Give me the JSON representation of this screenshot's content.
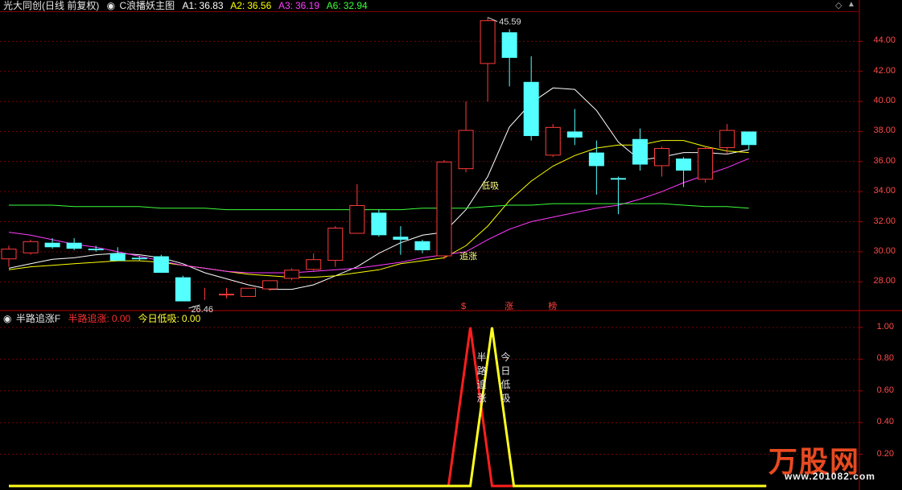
{
  "header": {
    "title": "光大同创(日线 前复权)",
    "indicator": "C浪播妖主图",
    "ma": [
      {
        "label": "A1:",
        "value": "36.83",
        "color": "#ffffff"
      },
      {
        "label": "A2:",
        "value": "36.56",
        "color": "#ffff00"
      },
      {
        "label": "A3:",
        "value": "36.19",
        "color": "#ff3cff"
      },
      {
        "label": "A6:",
        "value": "32.94",
        "color": "#3cff3c"
      }
    ]
  },
  "sub_header": {
    "title": "半路追涨F",
    "items": [
      {
        "label": "半路追涨:",
        "value": "0.00",
        "color": "#ff3030"
      },
      {
        "label": "今日低吸:",
        "value": "0.00",
        "color": "#ffff30"
      }
    ]
  },
  "colors": {
    "up": "#ff3b3b",
    "down": "#54ffff",
    "axis": "#b40000",
    "grid": "#7a0000"
  },
  "chart_data": [
    {
      "type": "candlestick",
      "y_ticks": [
        "28.00",
        "30.00",
        "32.00",
        "34.00",
        "36.00",
        "38.00",
        "40.00",
        "42.00",
        "44.00"
      ],
      "ylim": [
        26.3,
        46.0
      ],
      "grid": true,
      "candles": [
        {
          "o": 29.5,
          "h": 30.4,
          "l": 29.0,
          "c": 30.2
        },
        {
          "o": 29.9,
          "h": 30.8,
          "l": 29.8,
          "c": 30.7
        },
        {
          "o": 30.6,
          "h": 30.9,
          "l": 30.2,
          "c": 30.3
        },
        {
          "o": 30.6,
          "h": 30.9,
          "l": 30.1,
          "c": 30.2
        },
        {
          "o": 30.2,
          "h": 30.4,
          "l": 30.0,
          "c": 30.1
        },
        {
          "o": 29.9,
          "h": 30.3,
          "l": 29.4,
          "c": 29.4
        },
        {
          "o": 29.6,
          "h": 29.7,
          "l": 29.4,
          "c": 29.5
        },
        {
          "o": 29.7,
          "h": 29.8,
          "l": 28.6,
          "c": 28.6
        },
        {
          "o": 28.3,
          "h": 28.4,
          "l": 26.7,
          "c": 26.7
        },
        {
          "o": 27.0,
          "h": 27.6,
          "l": 26.8,
          "c": 27.0
        },
        {
          "o": 27.1,
          "h": 27.6,
          "l": 26.9,
          "c": 27.2
        },
        {
          "o": 27.0,
          "h": 27.6,
          "l": 27.0,
          "c": 27.6
        },
        {
          "o": 27.5,
          "h": 28.1,
          "l": 27.4,
          "c": 28.1
        },
        {
          "o": 28.2,
          "h": 28.9,
          "l": 28.1,
          "c": 28.8
        },
        {
          "o": 28.8,
          "h": 29.9,
          "l": 28.7,
          "c": 29.5
        },
        {
          "o": 29.4,
          "h": 31.7,
          "l": 29.0,
          "c": 31.6
        },
        {
          "o": 31.2,
          "h": 34.5,
          "l": 31.2,
          "c": 33.1
        },
        {
          "o": 32.6,
          "h": 32.8,
          "l": 31.0,
          "c": 31.1
        },
        {
          "o": 31.0,
          "h": 31.7,
          "l": 29.8,
          "c": 30.8
        },
        {
          "o": 30.7,
          "h": 30.8,
          "l": 29.9,
          "c": 30.1
        },
        {
          "o": 29.7,
          "h": 36.1,
          "l": 29.5,
          "c": 36.0
        },
        {
          "o": 35.5,
          "h": 40.0,
          "l": 35.3,
          "c": 38.1
        },
        {
          "o": 42.5,
          "h": 45.6,
          "l": 40.0,
          "c": 45.4
        },
        {
          "o": 44.6,
          "h": 44.8,
          "l": 41.0,
          "c": 42.9
        },
        {
          "o": 41.3,
          "h": 43.0,
          "l": 37.4,
          "c": 37.7
        },
        {
          "o": 36.4,
          "h": 38.5,
          "l": 36.3,
          "c": 38.3
        },
        {
          "o": 38.0,
          "h": 39.5,
          "l": 37.1,
          "c": 37.6
        },
        {
          "o": 36.6,
          "h": 37.4,
          "l": 33.8,
          "c": 35.7
        },
        {
          "o": 34.9,
          "h": 35.0,
          "l": 32.5,
          "c": 34.8
        },
        {
          "o": 37.5,
          "h": 38.2,
          "l": 35.4,
          "c": 35.8
        },
        {
          "o": 35.7,
          "h": 37.0,
          "l": 35.0,
          "c": 36.9
        },
        {
          "o": 36.2,
          "h": 36.3,
          "l": 34.3,
          "c": 35.4
        },
        {
          "o": 34.8,
          "h": 37.0,
          "l": 34.6,
          "c": 36.9
        },
        {
          "o": 36.9,
          "h": 38.5,
          "l": 36.5,
          "c": 38.1
        },
        {
          "o": 38.0,
          "h": 38.0,
          "l": 36.8,
          "c": 37.1
        }
      ],
      "lines": [
        {
          "key": "A1",
          "color": "#ffffff",
          "values": [
            28.9,
            29.2,
            29.5,
            29.6,
            29.8,
            29.9,
            29.8,
            29.6,
            29.2,
            28.6,
            28.2,
            27.8,
            27.5,
            27.5,
            27.8,
            28.4,
            29.0,
            29.9,
            30.6,
            31.1,
            31.3,
            32.8,
            35.0,
            38.3,
            39.9,
            40.9,
            40.8,
            39.4,
            37.3,
            36.1,
            36.3,
            36.6,
            36.6,
            36.5,
            36.8
          ]
        },
        {
          "key": "A2",
          "color": "#ffff00",
          "values": [
            28.8,
            29.0,
            29.1,
            29.2,
            29.3,
            29.4,
            29.4,
            29.3,
            29.1,
            28.9,
            28.7,
            28.5,
            28.4,
            28.3,
            28.3,
            28.4,
            28.6,
            28.8,
            29.2,
            29.4,
            29.6,
            30.4,
            31.7,
            33.4,
            34.7,
            35.7,
            36.4,
            36.9,
            37.1,
            37.1,
            37.4,
            37.4,
            37.0,
            36.7,
            36.6
          ]
        },
        {
          "key": "A3",
          "color": "#ff3cff",
          "values": [
            31.3,
            31.1,
            30.8,
            30.5,
            30.3,
            30.0,
            29.7,
            29.4,
            29.1,
            28.9,
            28.7,
            28.6,
            28.6,
            28.6,
            28.7,
            28.8,
            28.9,
            29.1,
            29.3,
            29.6,
            29.8,
            30.0,
            30.8,
            31.5,
            32.0,
            32.3,
            32.6,
            32.9,
            33.1,
            33.5,
            34.0,
            34.6,
            35.1,
            35.6,
            36.2
          ]
        },
        {
          "key": "A6",
          "color": "#3cff3c",
          "values": [
            33.1,
            33.1,
            33.1,
            33.0,
            33.0,
            33.0,
            33.0,
            32.9,
            32.9,
            32.9,
            32.8,
            32.8,
            32.8,
            32.8,
            32.8,
            32.8,
            32.8,
            32.8,
            32.8,
            32.9,
            32.9,
            32.9,
            33.0,
            33.1,
            33.1,
            33.2,
            33.2,
            33.2,
            33.2,
            33.2,
            33.2,
            33.1,
            33.0,
            33.0,
            32.9
          ]
        }
      ],
      "annotations": [
        {
          "text": "45.59",
          "index": 22,
          "value": 45.59
        },
        {
          "text": "26.46",
          "index": 9,
          "value": 26.46
        },
        {
          "text": "低吸",
          "index": 22,
          "value": 34.2
        },
        {
          "text": "追涨",
          "index": 21,
          "value": 29.5
        }
      ],
      "markers": [
        {
          "text": "$",
          "index": 21
        },
        {
          "text": "涨",
          "index": 23
        },
        {
          "text": "榜",
          "index": 25
        }
      ]
    },
    {
      "type": "line",
      "y_ticks": [
        "0.20",
        "0.40",
        "0.60",
        "0.80",
        "1.00"
      ],
      "ylim": [
        0,
        1.0
      ],
      "series": [
        {
          "name": "半路追涨",
          "color": "#ff1e1e",
          "x": [
            0,
            20.2,
            21.2,
            22.2,
            22.9,
            34.8
          ],
          "values": [
            0,
            0,
            1,
            0,
            0,
            0
          ]
        },
        {
          "name": "今日低吸",
          "color": "#ffff1e",
          "x": [
            0,
            21.2,
            22.2,
            23.2,
            34.8
          ],
          "values": [
            0,
            0,
            1,
            0,
            0
          ]
        }
      ],
      "labels": [
        {
          "text": "半路追涨",
          "index": 21.5
        },
        {
          "text": "今日低吸",
          "index": 22.6
        }
      ]
    }
  ]
}
